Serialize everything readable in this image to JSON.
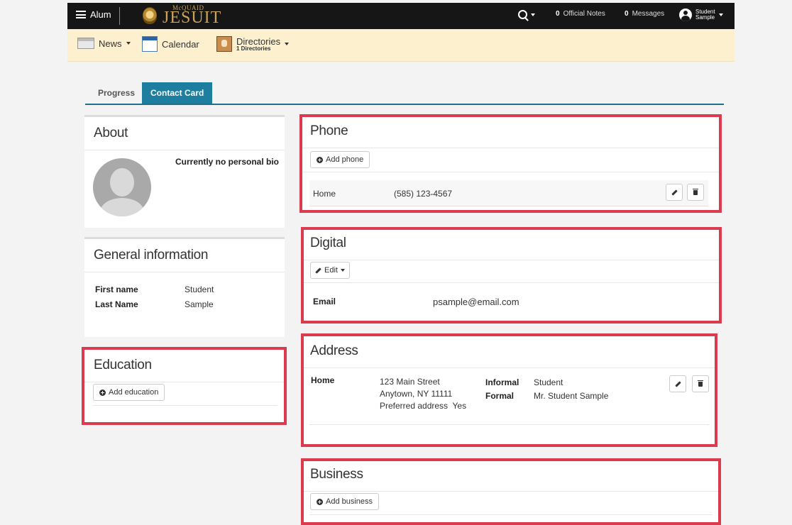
{
  "topnav": {
    "menu_label": "Alum",
    "brand_small": "McQUAID",
    "brand_big": "JESUIT",
    "notes_count": "0",
    "notes_label": "Official Notes",
    "messages_count": "0",
    "messages_label": "Messages",
    "user_first": "Student",
    "user_last": "Sample"
  },
  "subnav": {
    "news": "News",
    "calendar": "Calendar",
    "directories": "Directories",
    "directories_sub": "1 Directories"
  },
  "tabs": {
    "progress": "Progress",
    "contact_card": "Contact Card"
  },
  "about": {
    "title": "About",
    "bio": "Currently no personal bio"
  },
  "general": {
    "title": "General information",
    "first_name_label": "First name",
    "first_name": "Student",
    "last_name_label": "Last Name",
    "last_name": "Sample"
  },
  "education": {
    "title": "Education",
    "add_label": "Add education"
  },
  "phone": {
    "title": "Phone",
    "add_label": "Add phone",
    "entries": [
      {
        "type": "Home",
        "number": "(585) 123-4567"
      }
    ]
  },
  "digital": {
    "title": "Digital",
    "edit_label": "Edit",
    "email_label": "Email",
    "email": "psample@email.com"
  },
  "address": {
    "title": "Address",
    "type": "Home",
    "line1": "123 Main Street",
    "line2": "Anytown, NY 11111",
    "preferred": "Preferred address  Yes",
    "informal_label": "Informal",
    "informal": "Student",
    "formal_label": "Formal",
    "formal": "Mr. Student Sample"
  },
  "business": {
    "title": "Business",
    "add_label": "Add business"
  },
  "colors": {
    "highlight": "#dc3a4e",
    "tab_active": "#1e7ea0",
    "subnav_bg": "#fcf0cf",
    "topnav_bg": "#161616"
  }
}
